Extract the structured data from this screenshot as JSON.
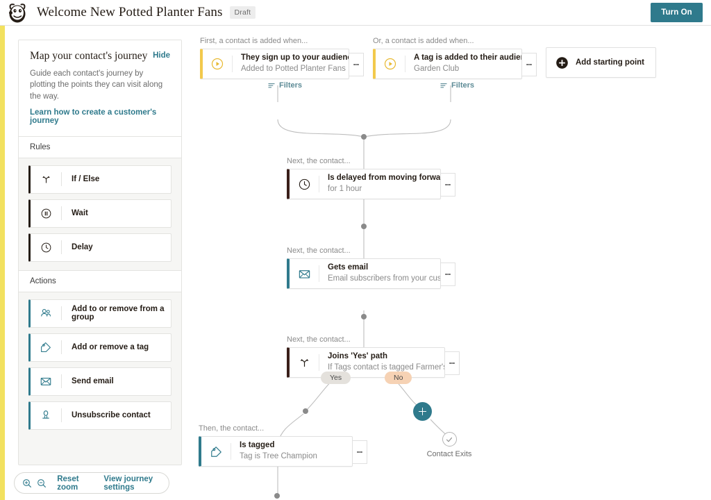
{
  "header": {
    "logo_icon": "mailchimp-logo-icon",
    "title": "Welcome New Potted Planter Fans",
    "status_badge": "Draft",
    "turn_on_label": "Turn On",
    "accent_color": "#2f7a8c",
    "stripe_color": "#f2e15f"
  },
  "sidebar": {
    "title": "Map your contact's journey",
    "hide_label": "Hide",
    "description": "Guide each contact's journey by plotting the points they can visit along the way.",
    "learn_link": "Learn how to create a customer's journey",
    "sections": [
      {
        "label": "Rules",
        "items": [
          {
            "label": "If / Else",
            "icon": "branch-icon",
            "accent": "dark"
          },
          {
            "label": "Wait",
            "icon": "pause-circle-icon",
            "accent": "dark"
          },
          {
            "label": "Delay",
            "icon": "clock-icon",
            "accent": "dark"
          }
        ]
      },
      {
        "label": "Actions",
        "items": [
          {
            "label": "Add to or remove from a group",
            "icon": "group-icon",
            "accent": "teal"
          },
          {
            "label": "Add or remove a tag",
            "icon": "tag-icon",
            "accent": "teal"
          },
          {
            "label": "Send email",
            "icon": "envelope-icon",
            "accent": "teal"
          },
          {
            "label": "Unsubscribe contact",
            "icon": "person-icon",
            "accent": "teal"
          }
        ]
      }
    ]
  },
  "zoom_bar": {
    "zoom_in_icon": "zoom-in-icon",
    "zoom_out_icon": "zoom-out-icon",
    "reset_label": "Reset zoom",
    "settings_label": "View journey settings"
  },
  "canvas": {
    "starting_points": [
      {
        "caption": "First, a contact is added when...",
        "title": "They sign up to your audience",
        "subtitle": "Added to Potted Planter Fans",
        "icon": "play-circle-icon",
        "accent": "yellow",
        "filters_label": "Filters"
      },
      {
        "caption": "Or, a contact is added when...",
        "title": "A tag is added to their audience data",
        "subtitle": "Garden Club",
        "icon": "play-circle-icon",
        "accent": "yellow",
        "filters_label": "Filters"
      }
    ],
    "add_starting_point_label": "Add starting point",
    "steps": [
      {
        "caption": "Next, the contact...",
        "title": "Is delayed from moving forward",
        "subtitle": "for 1 hour",
        "icon": "clock-icon",
        "accent": "dark"
      },
      {
        "caption": "Next, the contact...",
        "title": "Gets email",
        "subtitle": "Email subscribers from your customer j...",
        "icon": "envelope-icon",
        "accent": "teal"
      },
      {
        "caption": "Next, the contact...",
        "title": "Joins 'Yes' path",
        "subtitle": "If Tags contact is tagged Farmer's Market",
        "icon": "branch-icon",
        "accent": "dark"
      }
    ],
    "branch_labels": {
      "yes": "Yes",
      "no": "No"
    },
    "yes_branch_step": {
      "caption": "Then, the contact...",
      "title": "Is tagged",
      "subtitle": "Tag is Tree Champion",
      "icon": "tag-icon",
      "accent": "teal"
    },
    "exit_node": {
      "label": "Contact Exits",
      "icon": "check-circle-icon"
    },
    "add_step_icon": "plus-circle-icon",
    "kebab_icon": "kebab-menu-icon"
  }
}
